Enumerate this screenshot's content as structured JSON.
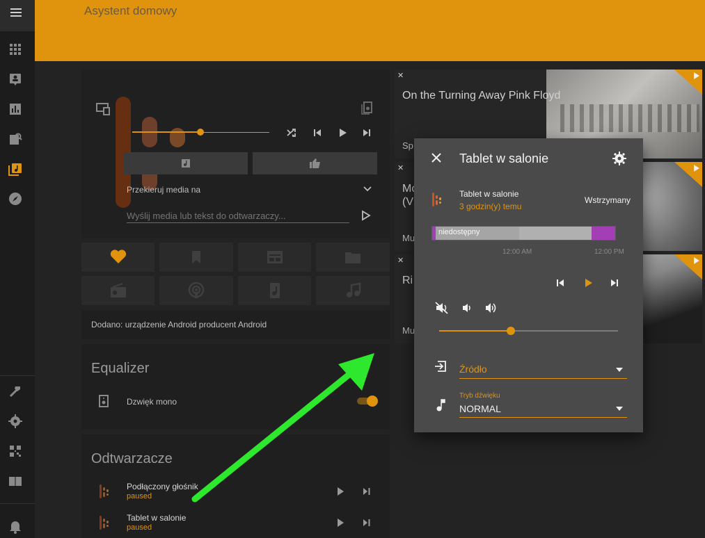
{
  "app": {
    "title": "Asystent domowy",
    "accent": "#e0940d"
  },
  "sidebar": {
    "items": [
      {
        "icon": "menu-icon"
      },
      {
        "icon": "apps-grid-icon"
      },
      {
        "icon": "person-card-icon"
      },
      {
        "icon": "bar-chart-icon"
      },
      {
        "icon": "image-search-icon"
      },
      {
        "icon": "music-library-icon",
        "active": true
      },
      {
        "icon": "compass-icon"
      },
      {
        "icon": "hammer-icon"
      },
      {
        "icon": "gear-icon"
      },
      {
        "icon": "qr-code-icon"
      },
      {
        "icon": "book-icon"
      },
      {
        "icon": "bell-icon"
      }
    ]
  },
  "player": {
    "redirect_label": "Przekieruj media na",
    "send_placeholder": "Wyślij media lub tekst do odtwarzaczy...",
    "progress": 0.5
  },
  "tiles_row1": [
    {
      "icon": "heart-icon",
      "active": true
    },
    {
      "icon": "bookmark-icon"
    },
    {
      "icon": "calendar-view-icon"
    },
    {
      "icon": "folder-icon"
    }
  ],
  "tiles_row2": [
    {
      "icon": "radio-icon"
    },
    {
      "icon": "podcast-icon"
    },
    {
      "icon": "audio-file-icon"
    },
    {
      "icon": "music-note-icon"
    }
  ],
  "notice": {
    "text": "Dodano: urządzenie Android producent Android"
  },
  "equalizer": {
    "title": "Equalizer",
    "mono_label": "Dzwięk mono",
    "mono_on": true
  },
  "players": {
    "title": "Odtwarzacze",
    "items": [
      {
        "name": "Podłączony głośnik",
        "status": "paused"
      },
      {
        "name": "Tablet w salonie",
        "status": "paused"
      }
    ]
  },
  "media": {
    "items": [
      {
        "title": "On the Turning Away Pink Floyd",
        "subtitle": "Sp"
      },
      {
        "title": "Mo\n(V",
        "subtitle": "Mu"
      },
      {
        "title": "Ri",
        "subtitle": "Mu"
      }
    ]
  },
  "dialog": {
    "title": "Tablet w salonie",
    "entity_name": "Tablet w salonie",
    "entity_time": "3 godzin(y) temu",
    "state": "Wstrzymany",
    "timeline_label": "niedostępny",
    "timeline_ticks": [
      "12:00 AM",
      "12:00 PM"
    ],
    "volume": 0.4,
    "source_label": "Źródło",
    "sound_mode_label": "Tryb dźwięku",
    "sound_mode_value": "NORMAL",
    "timeline_colors": {
      "unavailable": "#9e9e9e",
      "playing": "#a23fb5"
    }
  }
}
